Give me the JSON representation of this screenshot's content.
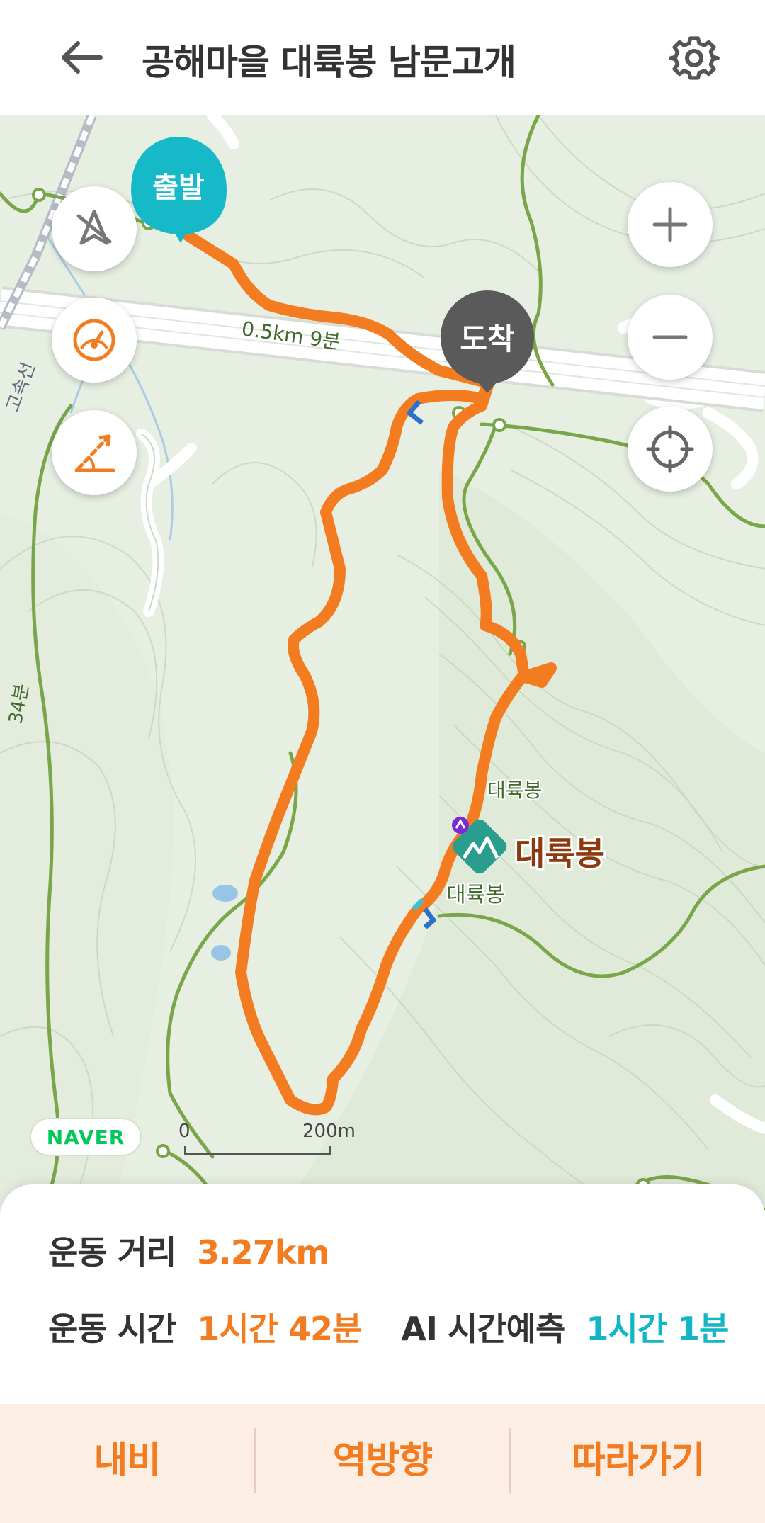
{
  "header": {
    "title": "공해마을 대륙봉 남문고개",
    "back_icon": "arrow-left-icon",
    "settings_icon": "gear-icon"
  },
  "map": {
    "start_label": "출발",
    "end_label": "도착",
    "peak_label": "대륙봉",
    "peak_small_label": "대륙봉",
    "peak_small_label2": "대륙봉",
    "road_label": "0.5km 9분",
    "road_label_left": "고속선",
    "trail_time_label": "34분",
    "naver_logo": "NAVER",
    "scale_start": "0",
    "scale_end": "200m",
    "colors": {
      "route": "#f47c20",
      "start_pin": "#16b9c8",
      "end_pin": "#5a5a5a",
      "trail": "#7aa64a",
      "peak_marker": "#2a9d8f"
    }
  },
  "controls": {
    "compass_off_icon": "compass-off-icon",
    "speedometer_icon": "speedometer-icon",
    "slope_icon": "slope-icon",
    "zoom_in_icon": "plus-icon",
    "zoom_out_icon": "minus-icon",
    "locate_icon": "crosshair-icon"
  },
  "stats": {
    "distance_label": "운동 거리",
    "distance_value": "3.27km",
    "time_label": "운동 시간",
    "time_value": "1시간 42분",
    "ai_label": "AI 시간예측",
    "ai_value": "1시간 1분"
  },
  "actions": {
    "navi": "내비",
    "reverse": "역방향",
    "follow": "따라가기"
  }
}
